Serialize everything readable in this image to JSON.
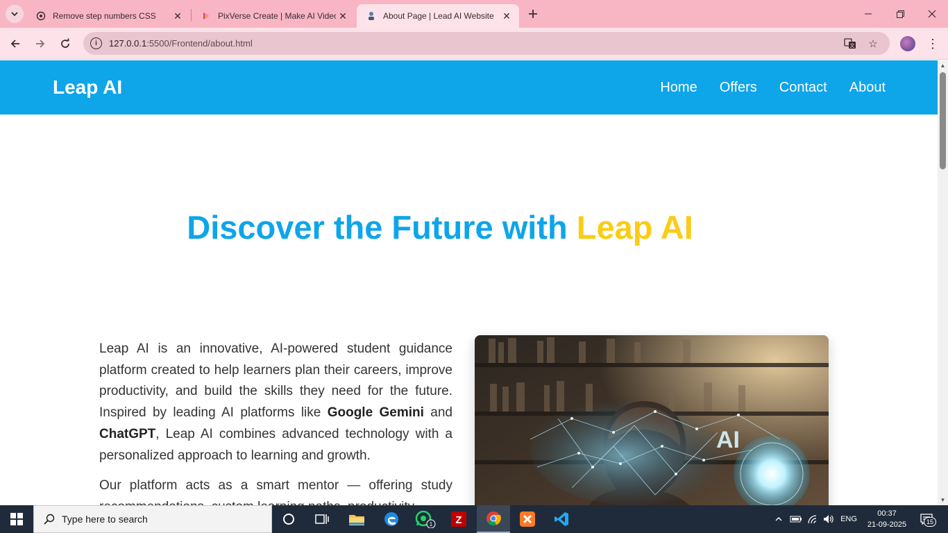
{
  "browser": {
    "tabs": [
      {
        "title": "Remove step numbers CSS",
        "icon": "chatgpt-icon",
        "active": false
      },
      {
        "title": "PixVerse Create | Make AI Video",
        "icon": "pixverse-icon",
        "active": false
      },
      {
        "title": "About Page | Lead AI Website",
        "icon": "site-icon",
        "active": true
      }
    ],
    "address": {
      "host": "127.0.0.1",
      "path": ":5500/Frontend/about.html"
    }
  },
  "site": {
    "brand": "Leap AI",
    "nav": [
      "Home",
      "Offers",
      "Contact",
      "About"
    ],
    "hero": {
      "part1": "Discover the Future with ",
      "part2": "Leap AI"
    },
    "about": {
      "p1_a": "Leap AI is an innovative, AI-powered student guidance platform created to help learners plan their careers, improve productivity, and build the skills they need for the future. Inspired by leading AI platforms like ",
      "p1_b1": "Google Gemini",
      "p1_c": " and ",
      "p1_b2": "ChatGPT",
      "p1_d": ", Leap AI combines advanced technology with a personalized approach to learning and growth.",
      "p2": "Our platform acts as a smart mentor — offering study recommendations, custom learning paths, productivity"
    },
    "image_label": "AI"
  },
  "taskbar": {
    "search_placeholder": "Type here to search",
    "language": "ENG",
    "time": "00:37",
    "date": "21-09-2025",
    "whatsapp_badge": "1",
    "notifications": "15"
  },
  "colors": {
    "nav_bg": "#0ea5e9",
    "accent_blue": "#0ea5e9",
    "accent_yellow": "#facc15",
    "tab_strip": "#f8b5c4"
  }
}
